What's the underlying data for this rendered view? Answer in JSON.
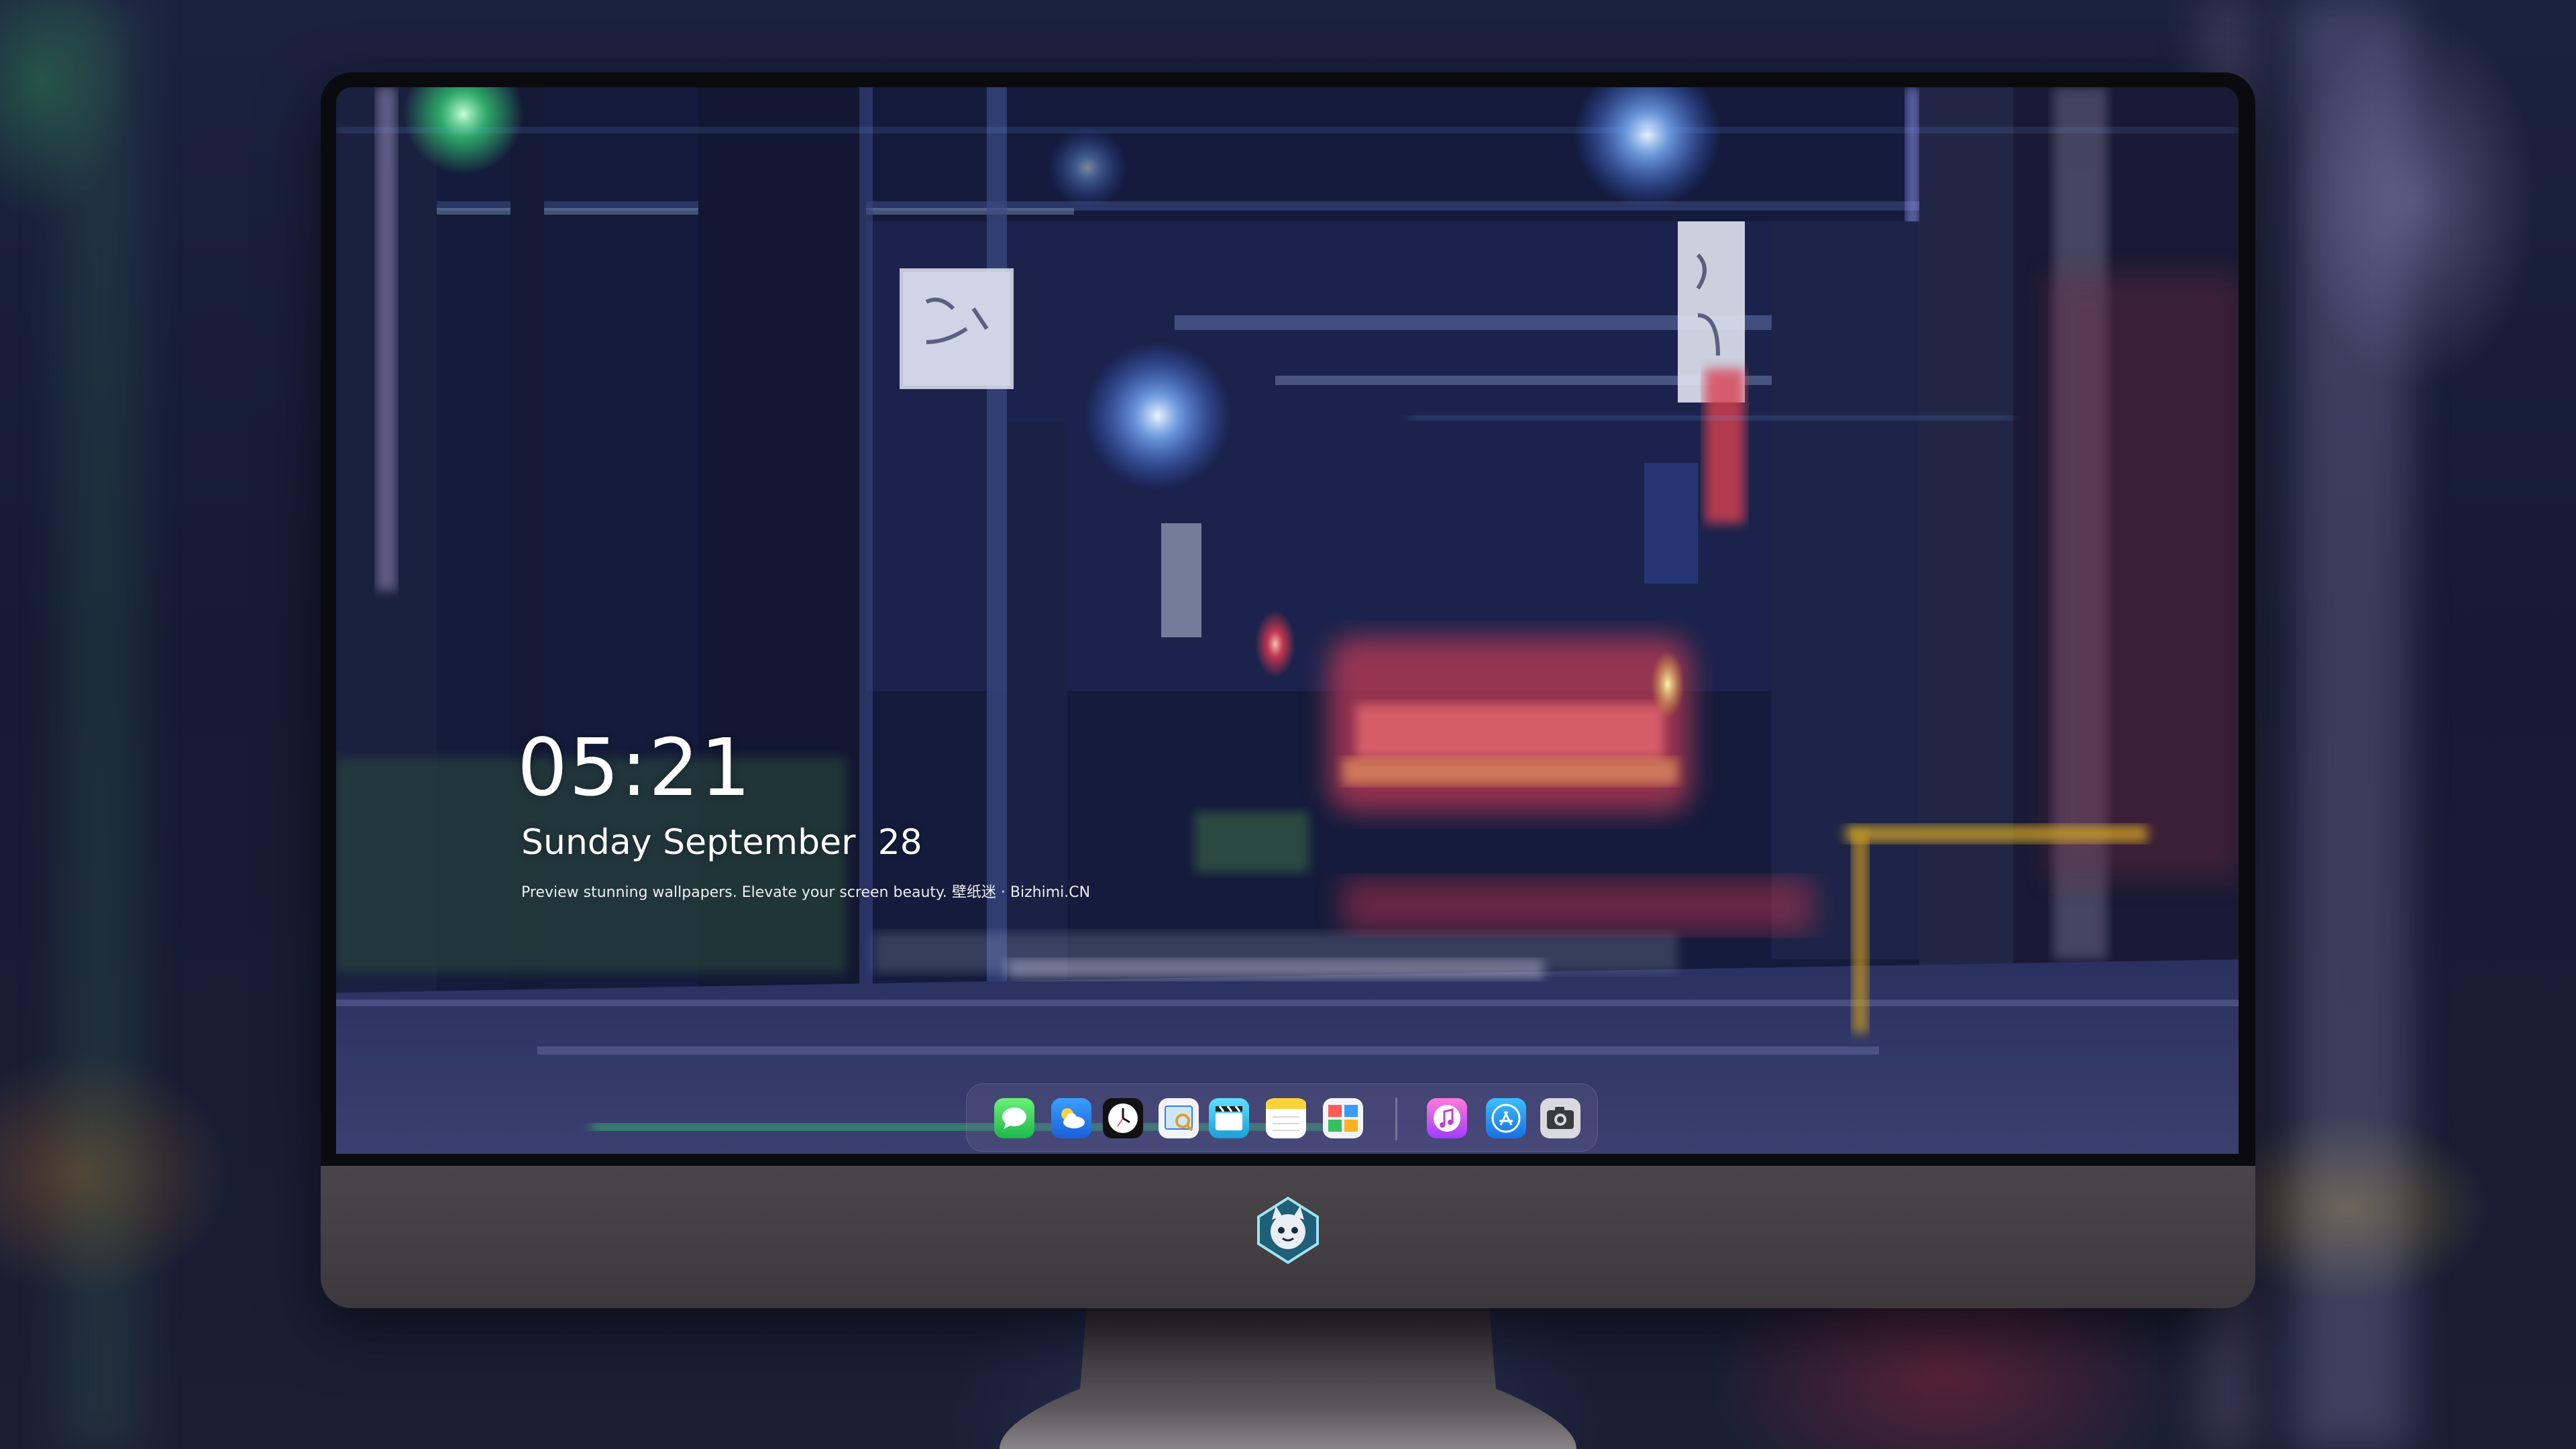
{
  "lockscreen": {
    "time": "05:21",
    "date": "Sunday September  28",
    "caption": "Preview stunning wallpapers. Elevate your screen beauty. 壁纸迷 · Bizhimi.CN"
  },
  "dock": {
    "apps": [
      {
        "icon": "messages-icon"
      },
      {
        "icon": "weather-icon"
      },
      {
        "icon": "clock-icon"
      },
      {
        "icon": "preview-icon"
      },
      {
        "icon": "clips-icon"
      },
      {
        "icon": "notes-icon"
      },
      {
        "icon": "photo-booth-icon"
      },
      {
        "icon": "music-icon"
      },
      {
        "icon": "app-store-icon"
      },
      {
        "icon": "camera-icon"
      }
    ]
  },
  "theme": {
    "bezel": "#0b0b0f",
    "chin": "#4a4548",
    "screen_top": "#0e1430",
    "neon_red": "#ff3b4f",
    "neon_blue": "#6fa8ff",
    "neon_green": "#36e07a"
  }
}
